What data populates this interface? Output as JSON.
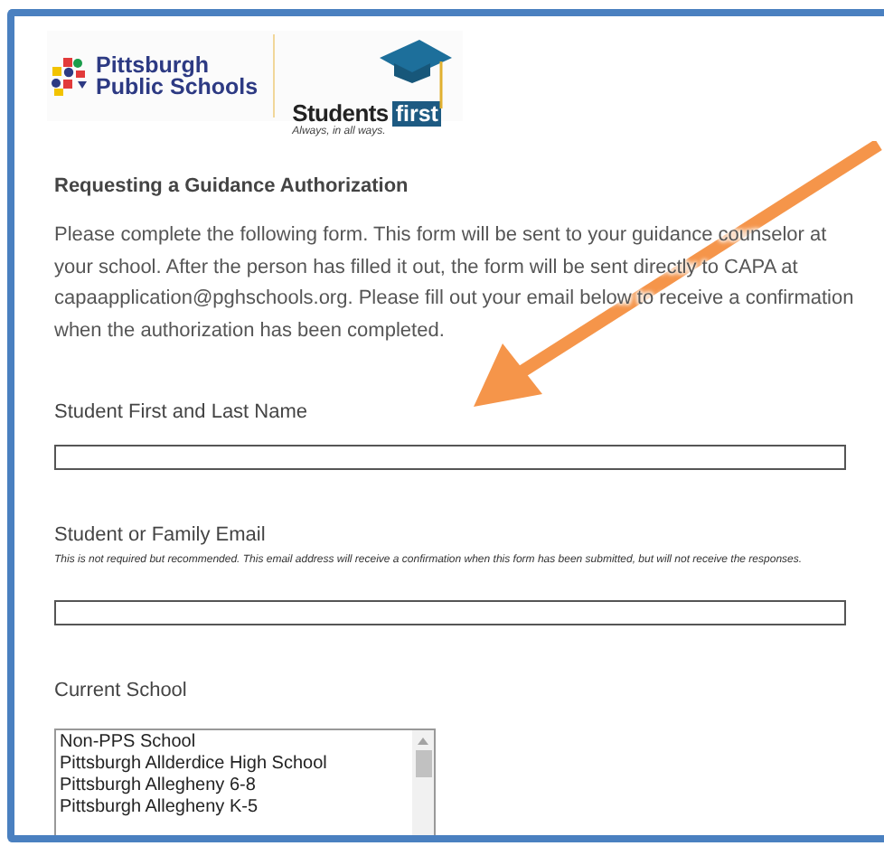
{
  "logo": {
    "org_name": [
      "Pittsburgh",
      "Public Schools"
    ],
    "brand_word": "Students",
    "brand_badge": "first",
    "tagline": "Always, in all ways."
  },
  "form": {
    "title": "Requesting a Guidance Authorization",
    "intro": "Please complete the following form. This form will be sent to your guidance counselor at your school. After the person has filled it out, the form will be sent directly to CAPA at capaapplication@pghschools.org. Please fill out your email below to receive a confirmation when the authorization has been completed.",
    "fields": [
      {
        "kind": "text",
        "label": "Student First and Last Name"
      },
      {
        "kind": "text",
        "label": "Student or Family Email",
        "note": "This is not required but recommended. This email address will receive a confirmation when this form has been submitted, but will not receive the responses."
      },
      {
        "kind": "list",
        "label": "Current School",
        "options": [
          {
            "label": "Non-PPS School",
            "selected": false
          },
          {
            "label": "Pittsburgh Allderdice High School",
            "selected": false
          },
          {
            "label": "Pittsburgh Allegheny 6-8",
            "selected": false
          },
          {
            "label": "Pittsburgh Allegheny K-5",
            "selected": false
          }
        ]
      }
    ]
  }
}
